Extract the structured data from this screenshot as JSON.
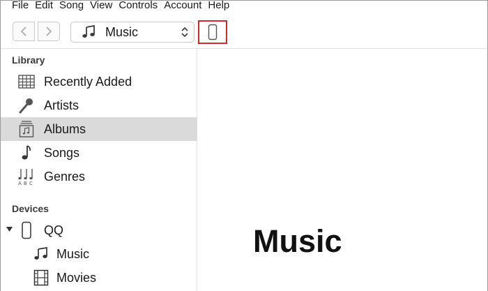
{
  "menu": [
    "File",
    "Edit",
    "Song",
    "View",
    "Controls",
    "Account",
    "Help"
  ],
  "toolbar": {
    "media_selector": "Music"
  },
  "sidebar": {
    "library_label": "Library",
    "library_items": [
      {
        "label": "Recently Added",
        "icon": "grid-icon"
      },
      {
        "label": "Artists",
        "icon": "microphone-icon"
      },
      {
        "label": "Albums",
        "icon": "album-icon",
        "selected": true
      },
      {
        "label": "Songs",
        "icon": "note-icon"
      },
      {
        "label": "Genres",
        "icon": "genres-icon"
      }
    ],
    "devices_label": "Devices",
    "device": {
      "label": "QQ",
      "icon": "phone-icon"
    },
    "device_items": [
      {
        "label": "Music",
        "icon": "note-icon"
      },
      {
        "label": "Movies",
        "icon": "film-icon"
      }
    ]
  },
  "main": {
    "title": "Music"
  },
  "colors": {
    "highlight_border": "#d9262e",
    "selected_row": "#dadada"
  }
}
